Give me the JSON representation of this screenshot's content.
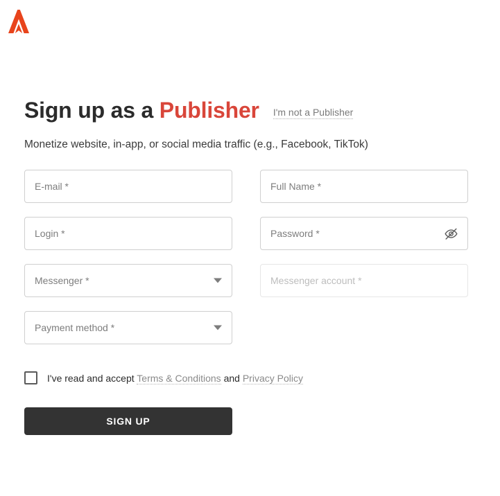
{
  "brand": {
    "logo_icon": "letter-a-logo-icon",
    "accent_color": "#d9463a",
    "button_color": "#333333"
  },
  "header": {
    "title_prefix": "Sign up as a",
    "title_accent": "Publisher",
    "switch_role_link": "I'm not a Publisher",
    "subtitle": "Monetize website, in-app, or social media traffic (e.g., Facebook, TikTok)"
  },
  "form": {
    "fields": {
      "email": {
        "placeholder": "E-mail *",
        "value": ""
      },
      "full_name": {
        "placeholder": "Full Name *",
        "value": ""
      },
      "login": {
        "placeholder": "Login *",
        "value": ""
      },
      "password": {
        "placeholder": "Password *",
        "value": "",
        "toggle_icon": "eye-off-icon"
      },
      "messenger": {
        "placeholder": "Messenger *",
        "value": "",
        "caret_icon": "chevron-down-icon"
      },
      "messenger_account": {
        "placeholder": "Messenger account *",
        "value": "",
        "disabled": true
      },
      "payment_method": {
        "placeholder": "Payment method *",
        "value": "",
        "caret_icon": "chevron-down-icon"
      }
    },
    "terms": {
      "prefix": "I've read and accept",
      "terms_link": "Terms & Conditions",
      "conjunction": "and",
      "privacy_link": "Privacy Policy",
      "checked": false
    },
    "submit_label": "SIGN UP"
  }
}
